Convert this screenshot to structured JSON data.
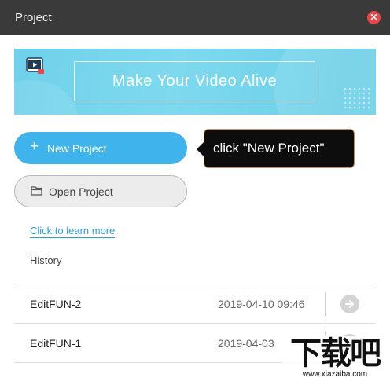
{
  "window": {
    "title": "Project",
    "close_icon": "close-icon"
  },
  "banner": {
    "slogan": "Make Your Video Alive",
    "logo_icon": "video-editor-logo-icon"
  },
  "actions": {
    "new_project_label": "New Project",
    "open_project_label": "Open Project",
    "new_icon": "plus-icon",
    "open_icon": "folder-icon"
  },
  "tooltip": {
    "text": "click \"New Project\""
  },
  "links": {
    "learn_more": "Click to learn more"
  },
  "history": {
    "label": "History",
    "items": [
      {
        "name": "EditFUN-2",
        "date": "2019-04-10 09:46"
      },
      {
        "name": "EditFUN-1",
        "date": "2019-04-03"
      }
    ]
  },
  "watermark": {
    "text": "下载吧",
    "url": "www.xiazaiba.com"
  },
  "colors": {
    "titlebar": "#3a3a3a",
    "accent": "#3fb3ec",
    "banner": "#6fd1ea",
    "close": "#e8474a",
    "link": "#2d9fd8"
  }
}
